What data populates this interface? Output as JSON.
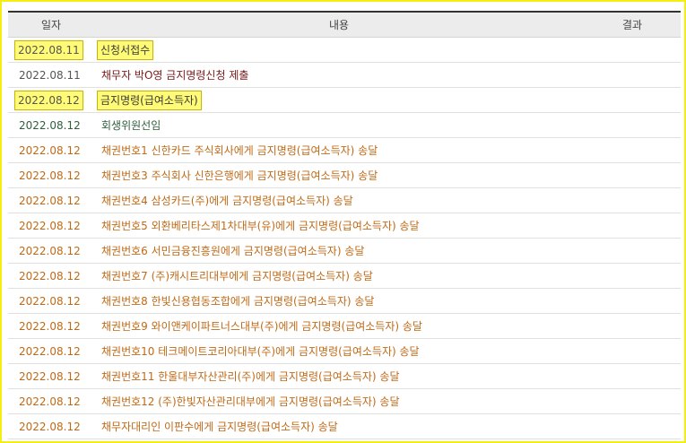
{
  "table": {
    "headers": {
      "date": "일자",
      "content": "내용",
      "result": "결과"
    },
    "rows": [
      {
        "date": "2022.08.11",
        "content": "신청서접수",
        "result": "",
        "highlight": true,
        "content_color": "#3a3a3a"
      },
      {
        "date": "2022.08.11",
        "content": "채무자 박O영 금지명령신청 제출",
        "result": "",
        "highlight": false,
        "content_color": "#7a1a1a"
      },
      {
        "date": "2022.08.12",
        "content": "금지명령(급여소득자)",
        "result": "",
        "highlight": true,
        "content_color": "#3a3a3a"
      },
      {
        "date": "2022.08.12",
        "content": "회생위원선임",
        "result": "",
        "highlight": false,
        "content_color": "#2f5e3c"
      },
      {
        "date": "2022.08.12",
        "content": "채권번호1 신한카드 주식회사에게 금지명령(급여소득자) 송달",
        "result": "",
        "highlight": false,
        "content_color": "#c06a17"
      },
      {
        "date": "2022.08.12",
        "content": "채권번호3 주식회사 신한은행에게 금지명령(급여소득자) 송달",
        "result": "",
        "highlight": false,
        "content_color": "#c06a17"
      },
      {
        "date": "2022.08.12",
        "content": "채권번호4 삼성카드(주)에게 금지명령(급여소득자) 송달",
        "result": "",
        "highlight": false,
        "content_color": "#c06a17"
      },
      {
        "date": "2022.08.12",
        "content": "채권번호5 외환베리타스제1차대부(유)에게 금지명령(급여소득자) 송달",
        "result": "",
        "highlight": false,
        "content_color": "#c06a17"
      },
      {
        "date": "2022.08.12",
        "content": "채권번호6 서민금융진흥원에게 금지명령(급여소득자) 송달",
        "result": "",
        "highlight": false,
        "content_color": "#c06a17"
      },
      {
        "date": "2022.08.12",
        "content": "채권번호7 (주)캐시트리대부에게 금지명령(급여소득자) 송달",
        "result": "",
        "highlight": false,
        "content_color": "#c06a17"
      },
      {
        "date": "2022.08.12",
        "content": "채권번호8 한빛신용협동조합에게 금지명령(급여소득자) 송달",
        "result": "",
        "highlight": false,
        "content_color": "#c06a17"
      },
      {
        "date": "2022.08.12",
        "content": "채권번호9 와이앤케이파트너스대부(주)에게 금지명령(급여소득자) 송달",
        "result": "",
        "highlight": false,
        "content_color": "#c06a17"
      },
      {
        "date": "2022.08.12",
        "content": "채권번호10 테크메이트코리아대부(주)에게 금지명령(급여소득자) 송달",
        "result": "",
        "highlight": false,
        "content_color": "#c06a17"
      },
      {
        "date": "2022.08.12",
        "content": "채권번호11 한울대부자산관리(주)에게 금지명령(급여소득자) 송달",
        "result": "",
        "highlight": false,
        "content_color": "#c06a17"
      },
      {
        "date": "2022.08.12",
        "content": "채권번호12 (주)한빛자산관리대부에게 금지명령(급여소득자) 송달",
        "result": "",
        "highlight": false,
        "content_color": "#c06a17"
      },
      {
        "date": "2022.08.12",
        "content": "채무자대리인 이판수에게 금지명령(급여소득자) 송달",
        "result": "",
        "highlight": false,
        "content_color": "#c06a17"
      }
    ]
  },
  "colors": {
    "highlight_fill": "#fffb76",
    "frame_border": "#f5ee12",
    "header_bg": "#ececec"
  }
}
